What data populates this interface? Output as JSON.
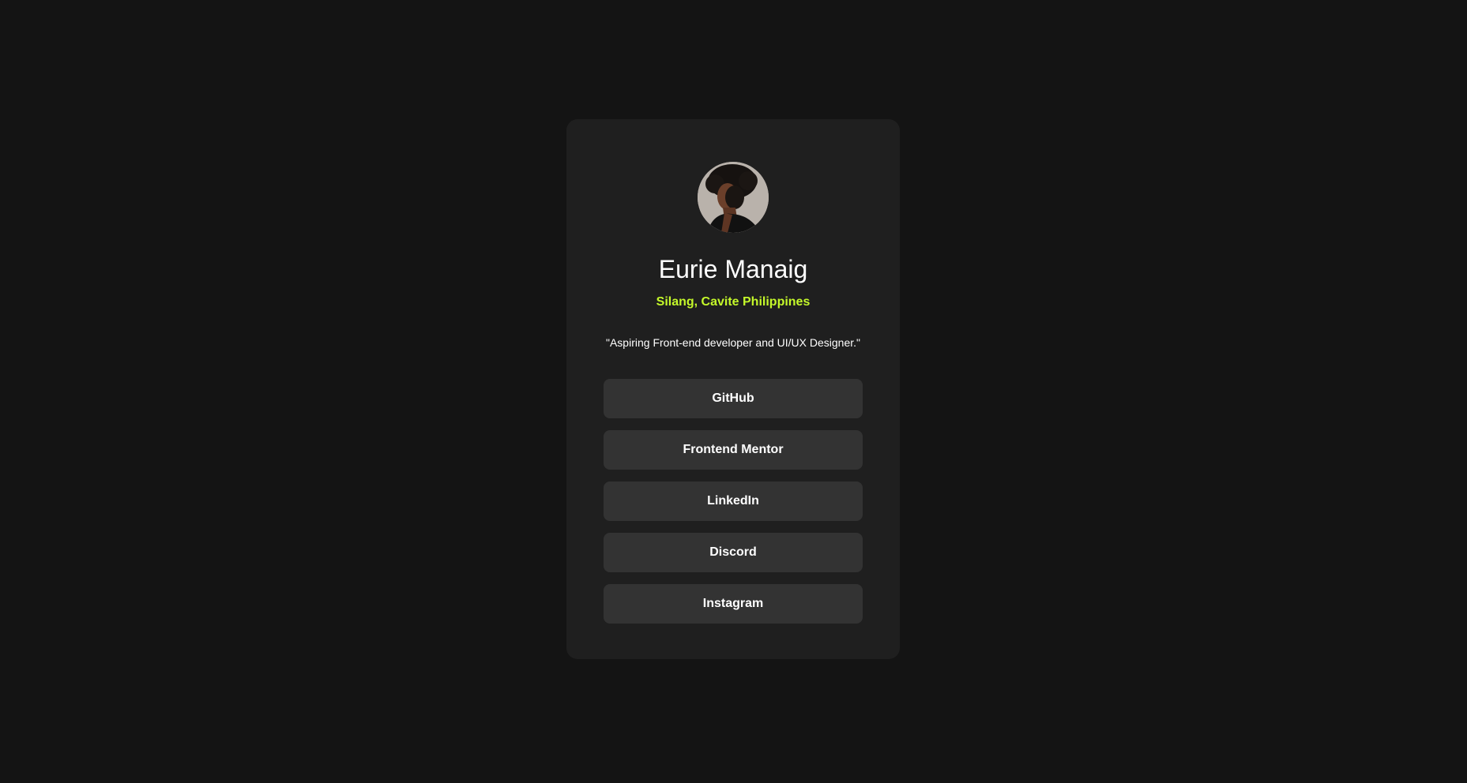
{
  "profile": {
    "avatar": "avatar-photo",
    "name": "Eurie Manaig",
    "location": "Silang, Cavite Philippines",
    "bio": "\"Aspiring Front-end developer and UI/UX Designer.\""
  },
  "links": [
    {
      "label": "GitHub"
    },
    {
      "label": "Frontend Mentor"
    },
    {
      "label": "LinkedIn"
    },
    {
      "label": "Discord"
    },
    {
      "label": "Instagram"
    }
  ],
  "colors": {
    "background": "#141414",
    "card": "#1f1f1f",
    "button": "#333333",
    "accent": "#c4f82a",
    "text": "#ffffff"
  }
}
